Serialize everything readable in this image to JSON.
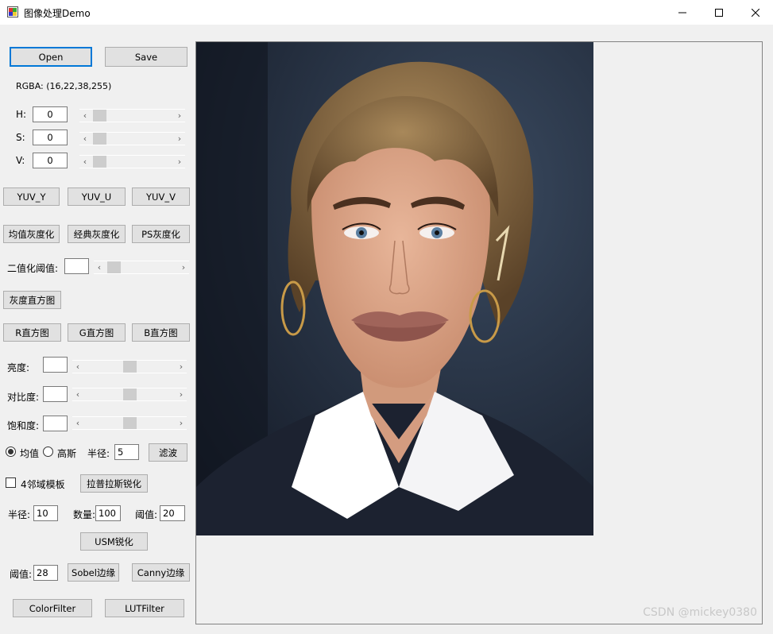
{
  "window": {
    "title": "图像处理Demo"
  },
  "buttons": {
    "open": "Open",
    "save": "Save",
    "yuv_y": "YUV_Y",
    "yuv_u": "YUV_U",
    "yuv_v": "YUV_V",
    "gray_mean": "均值灰度化",
    "gray_classic": "经典灰度化",
    "gray_ps": "PS灰度化",
    "gray_hist": "灰度直方图",
    "r_hist": "R直方图",
    "g_hist": "G直方图",
    "b_hist": "B直方图",
    "filter": "滤波",
    "laplace": "拉普拉斯锐化",
    "usm": "USM锐化",
    "sobel": "Sobel边缘",
    "canny": "Canny边缘",
    "color_filter": "ColorFilter",
    "lut_filter": "LUTFilter"
  },
  "rgba_label": "RGBA: (16,22,38,255)",
  "hsv": {
    "h_label": "H:",
    "h_value": "0",
    "s_label": "S:",
    "s_value": "0",
    "v_label": "V:",
    "v_value": "0"
  },
  "binarize": {
    "label": "二值化阈值:",
    "value": ""
  },
  "adjust": {
    "brightness_label": "亮度:",
    "brightness_value": "",
    "contrast_label": "对比度:",
    "contrast_value": "",
    "saturation_label": "饱和度:",
    "saturation_value": ""
  },
  "filter_opts": {
    "mean_label": "均值",
    "gauss_label": "高斯",
    "radius_label": "半径:",
    "radius_value": "5",
    "selected": "均值"
  },
  "laplace_opts": {
    "neighbor4_label": "4邻域模板",
    "checked": false
  },
  "usm": {
    "radius_label": "半径:",
    "radius_value": "10",
    "amount_label": "数量:",
    "amount_value": "100",
    "threshold_label": "阈值:",
    "threshold_value": "20"
  },
  "edge": {
    "threshold_label": "阈值:",
    "threshold_value": "28"
  },
  "sliders": {
    "h": 0,
    "s": 0,
    "v": 0,
    "binarize": 0,
    "brightness": 0.5,
    "contrast": 0.5,
    "saturation": 0.5
  },
  "watermark": "CSDN @mickey0380",
  "colors": {
    "accent": "#0078d7",
    "panel": "#f0f0f0"
  }
}
